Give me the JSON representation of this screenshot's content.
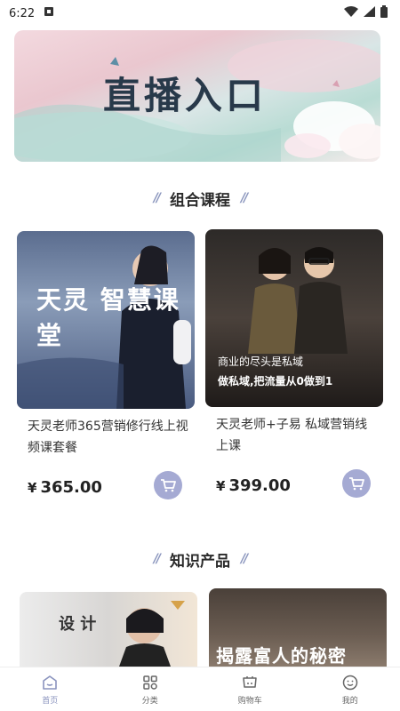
{
  "status": {
    "time": "6:22"
  },
  "banner": {
    "title": "直播入口"
  },
  "sections": {
    "combo": "组合课程",
    "knowledge": "知识产品"
  },
  "combo_cards": [
    {
      "name": "天灵老师365营销修行线上视频课套餐",
      "currency": "¥",
      "price": "365.00",
      "image_text": "天灵 智慧课堂"
    },
    {
      "name": "天灵老师+子易 私域营销线上课",
      "currency": "¥",
      "price": "399.00",
      "image_text_1": "商业的尽头是私域",
      "image_text_2": "做私域,把流量从0做到1"
    }
  ],
  "knowledge_cards": [
    {
      "image_text": "设 计"
    },
    {
      "image_text": "揭露富人的秘密"
    }
  ],
  "tabs": [
    {
      "label": "首页",
      "icon": "home-icon"
    },
    {
      "label": "分类",
      "icon": "category-icon"
    },
    {
      "label": "购物车",
      "icon": "cart-icon"
    },
    {
      "label": "我的",
      "icon": "profile-icon"
    }
  ],
  "colors": {
    "accent": "#8a93be",
    "cart_button": "#a5aad3"
  }
}
